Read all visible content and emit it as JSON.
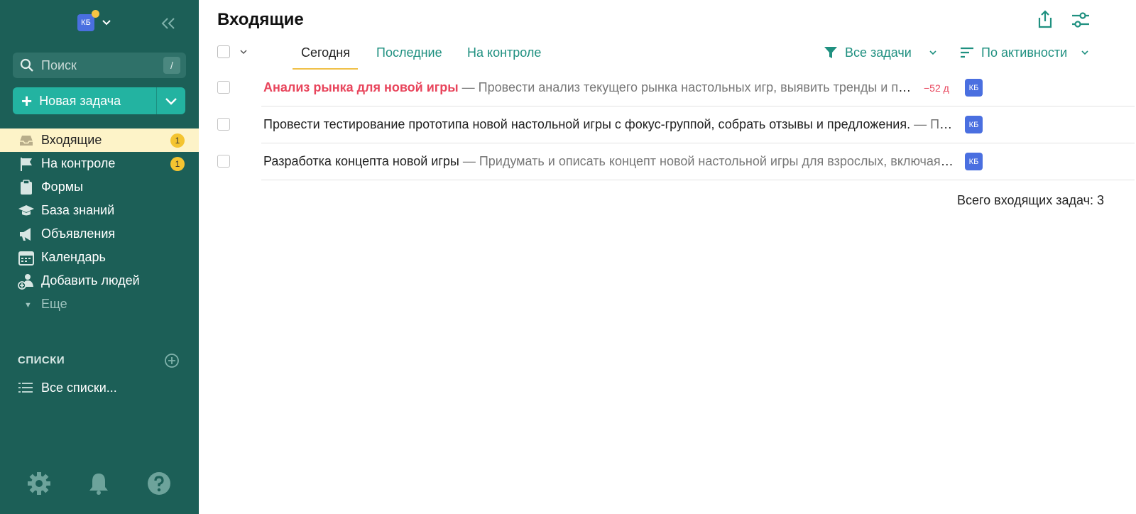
{
  "user": {
    "initials": "КБ"
  },
  "search": {
    "placeholder": "Поиск",
    "shortcut": "/"
  },
  "new_task": {
    "label": "Новая задача"
  },
  "nav": {
    "items": [
      {
        "label": "Входящие",
        "badge": "1"
      },
      {
        "label": "На контроле",
        "badge": "1"
      },
      {
        "label": "Формы"
      },
      {
        "label": "База знаний"
      },
      {
        "label": "Объявления"
      },
      {
        "label": "Календарь"
      },
      {
        "label": "Добавить людей"
      }
    ],
    "more": "Еще"
  },
  "lists": {
    "title": "СПИСКИ",
    "all": "Все списки..."
  },
  "page": {
    "title": "Входящие"
  },
  "tabs": [
    {
      "label": "Сегодня",
      "active": true
    },
    {
      "label": "Последние"
    },
    {
      "label": "На контроле"
    }
  ],
  "filter": {
    "label": "Все задачи"
  },
  "sort": {
    "label": "По активности"
  },
  "tasks": [
    {
      "title": "Анализ рынка для новой игры",
      "separator": " — ",
      "desc": "Провести анализ текущего рынка настольных игр, выявить тренды и потенциальных конкурентов.",
      "due": "−52 д",
      "assignee": "КБ"
    },
    {
      "title": "Провести тестирование прототипа новой настольной игры с фокус-группой, собрать отзывы и предложения.",
      "separator": " — ",
      "desc": "Получить обратную связь",
      "assignee": "КБ"
    },
    {
      "title": "Разработка концепта новой игры",
      "separator": " — ",
      "desc": "Придумать и описать концепт новой настольной игры для взрослых, включая механику и тематику.",
      "assignee": "КБ"
    }
  ],
  "footer": {
    "total": "Всего входящих задач: 3"
  },
  "colors": {
    "sidebar": "#1c5f57",
    "accent": "#23b3a1",
    "active_bg": "#fdf3c8",
    "badge": "#f4c430",
    "link": "#1f9080",
    "overdue": "#e8455c",
    "avatar": "#4a6fe0"
  }
}
